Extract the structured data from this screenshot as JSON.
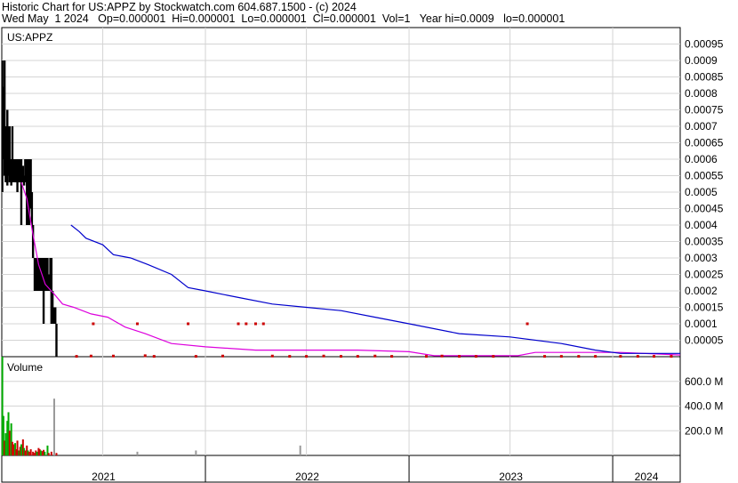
{
  "header": {
    "line1": "Historic Chart for US:APPZ by Stockwatch.com 604.687.1500 - (c) 2024",
    "line2": "Wed May  1 2024   Op=0.000001  Hi=0.000001  Lo=0.000001  Cl=0.000001  Vol=1   Year hi=0.0009   lo=0.000001"
  },
  "colors": {
    "price": "#000000",
    "ma_long": "#0000cc",
    "ma_short": "#dd00dd",
    "down_volume": "#cc0000",
    "up_volume": "#00aa00",
    "gray_volume": "#999999",
    "grid": "#d4d4d4"
  },
  "chart_data": [
    {
      "type": "line",
      "title": "US:APPZ",
      "ylim": [
        0,
        0.001
      ],
      "yticks": [
        "0.00005",
        "0.0001",
        "0.00015",
        "0.0002",
        "0.00025",
        "0.0003",
        "0.00035",
        "0.0004",
        "0.00045",
        "0.0005",
        "0.00055",
        "0.0006",
        "0.00065",
        "0.0007",
        "0.00075",
        "0.0008",
        "0.00085",
        "0.0009",
        "0.00095"
      ],
      "ytick_values": [
        5e-05,
        0.0001,
        0.00015,
        0.0002,
        0.00025,
        0.0003,
        0.00035,
        0.0004,
        0.00045,
        0.0005,
        0.00055,
        0.0006,
        0.00065,
        0.0007,
        0.00075,
        0.0008,
        0.00085,
        0.0009,
        0.00095
      ],
      "xlim": [
        "2021-01-01",
        "2024-05-01"
      ],
      "x_year_labels": [
        {
          "label": "2021",
          "start": "2021-01-01",
          "end": "2022-01-01"
        },
        {
          "label": "2022",
          "start": "2022-01-01",
          "end": "2023-01-01"
        },
        {
          "label": "2023",
          "start": "2023-01-01",
          "end": "2024-01-01"
        },
        {
          "label": "2024",
          "start": "2024-01-01",
          "end": "2024-05-01"
        }
      ],
      "grid_x": [
        "2021-07-01",
        "2022-01-01",
        "2022-07-01",
        "2023-01-01",
        "2023-07-01",
        "2024-01-01"
      ],
      "grid": true,
      "series": [
        {
          "kind": "ohlc",
          "bars": [
            {
              "x": "2021-01-02",
              "h": 0.0009,
              "l": 0.0005
            },
            {
              "x": "2021-01-04",
              "h": 0.00082,
              "l": 0.0006
            },
            {
              "x": "2021-01-06",
              "h": 0.0009,
              "l": 0.00055
            },
            {
              "x": "2021-01-08",
              "h": 0.0007,
              "l": 0.00053
            },
            {
              "x": "2021-01-11",
              "h": 0.00075,
              "l": 0.00052
            },
            {
              "x": "2021-01-13",
              "h": 0.0007,
              "l": 0.00055
            },
            {
              "x": "2021-01-15",
              "h": 0.0007,
              "l": 0.00053
            },
            {
              "x": "2021-01-18",
              "h": 0.0006,
              "l": 0.00052
            },
            {
              "x": "2021-01-20",
              "h": 0.0007,
              "l": 0.00053
            },
            {
              "x": "2021-01-22",
              "h": 0.0006,
              "l": 0.00053
            },
            {
              "x": "2021-01-25",
              "h": 0.0006,
              "l": 0.00053
            },
            {
              "x": "2021-01-27",
              "h": 0.0006,
              "l": 0.00053
            },
            {
              "x": "2021-01-29",
              "h": 0.0006,
              "l": 0.0005
            },
            {
              "x": "2021-02-01",
              "h": 0.0006,
              "l": 0.00053
            },
            {
              "x": "2021-02-03",
              "h": 0.0006,
              "l": 0.00053
            },
            {
              "x": "2021-02-05",
              "h": 0.0006,
              "l": 0.0004
            },
            {
              "x": "2021-02-08",
              "h": 0.00058,
              "l": 0.00053
            },
            {
              "x": "2021-02-10",
              "h": 0.00055,
              "l": 0.00052
            },
            {
              "x": "2021-02-12",
              "h": 0.0006,
              "l": 0.00053
            },
            {
              "x": "2021-02-15",
              "h": 0.0006,
              "l": 0.0004
            },
            {
              "x": "2021-02-17",
              "h": 0.0006,
              "l": 0.0004
            },
            {
              "x": "2021-02-19",
              "h": 0.0006,
              "l": 0.0004
            },
            {
              "x": "2021-02-22",
              "h": 0.0006,
              "l": 0.00045
            },
            {
              "x": "2021-02-24",
              "h": 0.0005,
              "l": 0.0004
            },
            {
              "x": "2021-02-26",
              "h": 0.0004,
              "l": 0.0003
            },
            {
              "x": "2021-03-01",
              "h": 0.0003,
              "l": 0.0002
            },
            {
              "x": "2021-03-03",
              "h": 0.0003,
              "l": 0.0002
            },
            {
              "x": "2021-03-05",
              "h": 0.0003,
              "l": 0.0002
            },
            {
              "x": "2021-03-08",
              "h": 0.0003,
              "l": 0.0002
            },
            {
              "x": "2021-03-10",
              "h": 0.0003,
              "l": 0.0002
            },
            {
              "x": "2021-03-12",
              "h": 0.0003,
              "l": 0.0002
            },
            {
              "x": "2021-03-15",
              "h": 0.0003,
              "l": 0.0002
            },
            {
              "x": "2021-03-17",
              "h": 0.0003,
              "l": 0.0001
            },
            {
              "x": "2021-03-19",
              "h": 0.0003,
              "l": 0.0002
            },
            {
              "x": "2021-03-22",
              "h": 0.0003,
              "l": 0.0002
            },
            {
              "x": "2021-03-24",
              "h": 0.0003,
              "l": 0.0002
            },
            {
              "x": "2021-03-26",
              "h": 0.00025,
              "l": 0.0002
            },
            {
              "x": "2021-03-29",
              "h": 0.0003,
              "l": 0.0002
            },
            {
              "x": "2021-03-31",
              "h": 0.0003,
              "l": 0.0001
            },
            {
              "x": "2021-04-02",
              "h": 0.0002,
              "l": 0.0001
            },
            {
              "x": "2021-04-05",
              "h": 0.00015,
              "l": 0.0001
            },
            {
              "x": "2021-04-07",
              "h": 0.00015,
              "l": 0.0001
            },
            {
              "x": "2021-04-09",
              "h": 0.0001,
              "l": 1e-06
            }
          ]
        },
        {
          "kind": "dots",
          "color": "#cc0000",
          "points": [
            {
              "x": "2021-05-15",
              "y": 1e-06
            },
            {
              "x": "2021-06-10",
              "y": 2e-06
            },
            {
              "x": "2021-06-14",
              "y": 0.0001
            },
            {
              "x": "2021-07-20",
              "y": 2e-06
            },
            {
              "x": "2021-09-01",
              "y": 0.0001
            },
            {
              "x": "2021-09-15",
              "y": 3e-06
            },
            {
              "x": "2021-10-01",
              "y": 1e-06
            },
            {
              "x": "2021-12-01",
              "y": 0.0001
            },
            {
              "x": "2021-12-15",
              "y": 1e-06
            },
            {
              "x": "2022-02-01",
              "y": 2e-06
            },
            {
              "x": "2022-03-01",
              "y": 0.0001
            },
            {
              "x": "2022-03-15",
              "y": 0.0001
            },
            {
              "x": "2022-04-01",
              "y": 0.0001
            },
            {
              "x": "2022-04-15",
              "y": 0.0001
            },
            {
              "x": "2022-05-01",
              "y": 2e-06
            },
            {
              "x": "2022-06-01",
              "y": 1e-06
            },
            {
              "x": "2022-07-01",
              "y": 1e-06
            },
            {
              "x": "2022-08-01",
              "y": 2e-06
            },
            {
              "x": "2022-09-01",
              "y": 1e-06
            },
            {
              "x": "2022-10-01",
              "y": 1e-06
            },
            {
              "x": "2022-11-01",
              "y": 2e-06
            },
            {
              "x": "2022-12-01",
              "y": 1e-06
            },
            {
              "x": "2023-02-01",
              "y": 1e-06
            },
            {
              "x": "2023-03-01",
              "y": 2e-06
            },
            {
              "x": "2023-04-01",
              "y": 1e-06
            },
            {
              "x": "2023-05-01",
              "y": 1e-06
            },
            {
              "x": "2023-06-01",
              "y": 1e-06
            },
            {
              "x": "2023-08-01",
              "y": 0.0001
            },
            {
              "x": "2023-09-01",
              "y": 1e-06
            },
            {
              "x": "2023-10-01",
              "y": 1e-06
            },
            {
              "x": "2023-11-01",
              "y": 1e-06
            },
            {
              "x": "2023-12-01",
              "y": 1e-06
            },
            {
              "x": "2024-01-15",
              "y": 1e-06
            },
            {
              "x": "2024-02-15",
              "y": 1e-06
            },
            {
              "x": "2024-03-15",
              "y": 1e-06
            },
            {
              "x": "2024-04-15",
              "y": 1e-06
            }
          ]
        },
        {
          "kind": "line",
          "color": "#dd00dd",
          "points": [
            {
              "x": "2021-02-05",
              "y": 0.00053
            },
            {
              "x": "2021-02-15",
              "y": 0.00048
            },
            {
              "x": "2021-02-25",
              "y": 0.00038
            },
            {
              "x": "2021-03-08",
              "y": 0.00028
            },
            {
              "x": "2021-03-20",
              "y": 0.00022
            },
            {
              "x": "2021-04-05",
              "y": 0.00019
            },
            {
              "x": "2021-04-20",
              "y": 0.00016
            },
            {
              "x": "2021-05-10",
              "y": 0.00015
            },
            {
              "x": "2021-06-10",
              "y": 0.00013
            },
            {
              "x": "2021-07-10",
              "y": 0.00012
            },
            {
              "x": "2021-08-10",
              "y": 9e-05
            },
            {
              "x": "2021-09-15",
              "y": 7e-05
            },
            {
              "x": "2021-11-01",
              "y": 4e-05
            },
            {
              "x": "2022-01-01",
              "y": 3e-05
            },
            {
              "x": "2022-04-01",
              "y": 2e-05
            },
            {
              "x": "2022-10-01",
              "y": 2e-05
            },
            {
              "x": "2023-01-01",
              "y": 1.5e-05
            },
            {
              "x": "2023-02-15",
              "y": 3e-06
            },
            {
              "x": "2023-07-15",
              "y": 3e-06
            },
            {
              "x": "2023-08-15",
              "y": 1.3e-05
            },
            {
              "x": "2024-01-15",
              "y": 1.3e-05
            },
            {
              "x": "2024-05-01",
              "y": 5e-06
            }
          ]
        },
        {
          "kind": "line",
          "color": "#0000cc",
          "points": [
            {
              "x": "2021-05-05",
              "y": 0.0004
            },
            {
              "x": "2021-05-20",
              "y": 0.00038
            },
            {
              "x": "2021-06-01",
              "y": 0.00036
            },
            {
              "x": "2021-07-01",
              "y": 0.00034
            },
            {
              "x": "2021-07-20",
              "y": 0.00031
            },
            {
              "x": "2021-08-20",
              "y": 0.0003
            },
            {
              "x": "2021-09-20",
              "y": 0.00028
            },
            {
              "x": "2021-11-01",
              "y": 0.00025
            },
            {
              "x": "2021-12-01",
              "y": 0.00021
            },
            {
              "x": "2022-01-01",
              "y": 0.0002
            },
            {
              "x": "2022-03-01",
              "y": 0.00018
            },
            {
              "x": "2022-05-01",
              "y": 0.00016
            },
            {
              "x": "2022-07-01",
              "y": 0.00015
            },
            {
              "x": "2022-09-01",
              "y": 0.00014
            },
            {
              "x": "2022-11-01",
              "y": 0.00012
            },
            {
              "x": "2023-01-01",
              "y": 0.0001
            },
            {
              "x": "2023-04-01",
              "y": 7e-05
            },
            {
              "x": "2023-07-01",
              "y": 6e-05
            },
            {
              "x": "2023-10-01",
              "y": 4e-05
            },
            {
              "x": "2023-12-01",
              "y": 2e-05
            },
            {
              "x": "2024-01-15",
              "y": 1e-05
            },
            {
              "x": "2024-05-01",
              "y": 1e-05
            }
          ]
        }
      ]
    },
    {
      "type": "bar",
      "title": "Volume",
      "ylim": [
        0,
        800000000
      ],
      "yticks": [
        "200.0 M",
        "400.0 M",
        "600.0 M"
      ],
      "ytick_values": [
        200000000,
        400000000,
        600000000
      ],
      "bars": [
        {
          "x": "2021-01-02",
          "v": 800000000,
          "c": "#00aa00"
        },
        {
          "x": "2021-01-04",
          "v": 320000000,
          "c": "#00aa00"
        },
        {
          "x": "2021-01-06",
          "v": 120000000,
          "c": "#cc0000"
        },
        {
          "x": "2021-01-08",
          "v": 180000000,
          "c": "#00aa00"
        },
        {
          "x": "2021-01-11",
          "v": 280000000,
          "c": "#00aa00"
        },
        {
          "x": "2021-01-13",
          "v": 350000000,
          "c": "#00aa00"
        },
        {
          "x": "2021-01-15",
          "v": 200000000,
          "c": "#cc0000"
        },
        {
          "x": "2021-01-18",
          "v": 260000000,
          "c": "#00aa00"
        },
        {
          "x": "2021-01-20",
          "v": 110000000,
          "c": "#cc0000"
        },
        {
          "x": "2021-01-22",
          "v": 90000000,
          "c": "#cc0000"
        },
        {
          "x": "2021-01-25",
          "v": 100000000,
          "c": "#00aa00"
        },
        {
          "x": "2021-01-27",
          "v": 50000000,
          "c": "#cc0000"
        },
        {
          "x": "2021-01-29",
          "v": 120000000,
          "c": "#cc0000"
        },
        {
          "x": "2021-02-01",
          "v": 40000000,
          "c": "#00aa00"
        },
        {
          "x": "2021-02-03",
          "v": 70000000,
          "c": "#cc0000"
        },
        {
          "x": "2021-02-05",
          "v": 90000000,
          "c": "#00aa00"
        },
        {
          "x": "2021-02-08",
          "v": 130000000,
          "c": "#cc0000"
        },
        {
          "x": "2021-02-10",
          "v": 60000000,
          "c": "#00aa00"
        },
        {
          "x": "2021-02-12",
          "v": 40000000,
          "c": "#cc0000"
        },
        {
          "x": "2021-02-15",
          "v": 80000000,
          "c": "#cc0000"
        },
        {
          "x": "2021-02-17",
          "v": 40000000,
          "c": "#00aa00"
        },
        {
          "x": "2021-02-19",
          "v": 30000000,
          "c": "#cc0000"
        },
        {
          "x": "2021-02-22",
          "v": 50000000,
          "c": "#cc0000"
        },
        {
          "x": "2021-02-26",
          "v": 30000000,
          "c": "#cc0000"
        },
        {
          "x": "2021-03-01",
          "v": 20000000,
          "c": "#cc0000"
        },
        {
          "x": "2021-03-03",
          "v": 40000000,
          "c": "#cc0000"
        },
        {
          "x": "2021-03-05",
          "v": 30000000,
          "c": "#00aa00"
        },
        {
          "x": "2021-03-08",
          "v": 60000000,
          "c": "#cc0000"
        },
        {
          "x": "2021-03-10",
          "v": 50000000,
          "c": "#cc0000"
        },
        {
          "x": "2021-03-12",
          "v": 40000000,
          "c": "#00aa00"
        },
        {
          "x": "2021-03-15",
          "v": 35000000,
          "c": "#cc0000"
        },
        {
          "x": "2021-03-17",
          "v": 45000000,
          "c": "#cc0000"
        },
        {
          "x": "2021-03-19",
          "v": 30000000,
          "c": "#00aa00"
        },
        {
          "x": "2021-03-24",
          "v": 80000000,
          "c": "#00aa00"
        },
        {
          "x": "2021-03-26",
          "v": 20000000,
          "c": "#cc0000"
        },
        {
          "x": "2021-03-31",
          "v": 30000000,
          "c": "#cc0000"
        },
        {
          "x": "2021-04-05",
          "v": 460000000,
          "c": "#999999"
        },
        {
          "x": "2021-04-09",
          "v": 20000000,
          "c": "#cc0000"
        },
        {
          "x": "2021-09-01",
          "v": 30000000,
          "c": "#999999"
        },
        {
          "x": "2021-12-15",
          "v": 40000000,
          "c": "#999999"
        },
        {
          "x": "2022-06-20",
          "v": 80000000,
          "c": "#999999"
        },
        {
          "x": "2024-04-20",
          "v": 10000000,
          "c": "#999999"
        }
      ]
    }
  ]
}
